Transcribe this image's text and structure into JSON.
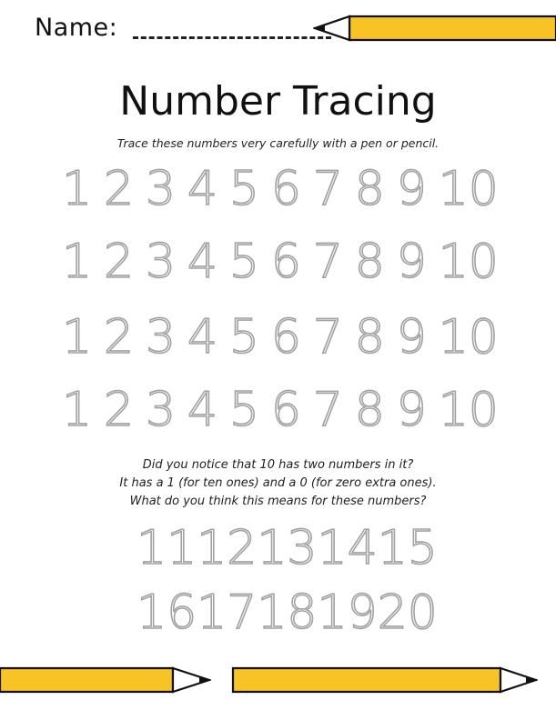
{
  "header": {
    "name_label": "Name:"
  },
  "title": "Number Tracing",
  "subtitle": "Trace these numbers very carefully with a pen or pencil.",
  "rows": [
    [
      "1",
      "2",
      "3",
      "4",
      "5",
      "6",
      "7",
      "8",
      "9",
      "10"
    ],
    [
      "1",
      "2",
      "3",
      "4",
      "5",
      "6",
      "7",
      "8",
      "9",
      "10"
    ],
    [
      "1",
      "2",
      "3",
      "4",
      "5",
      "6",
      "7",
      "8",
      "9",
      "10"
    ],
    [
      "1",
      "2",
      "3",
      "4",
      "5",
      "6",
      "7",
      "8",
      "9",
      "10"
    ]
  ],
  "note": {
    "line1": "Did you notice that 10 has two numbers in it?",
    "line2": "It has a 1 (for ten ones) and a 0 (for zero extra ones).",
    "line3": "What do you think this means for these numbers?"
  },
  "teen_rows": [
    [
      "11",
      "12",
      "13",
      "14",
      "15"
    ],
    [
      "16",
      "17",
      "18",
      "19",
      "20"
    ]
  ],
  "colors": {
    "pencil_body": "#F7C325",
    "outline": "#111111",
    "trace": "#555555"
  }
}
